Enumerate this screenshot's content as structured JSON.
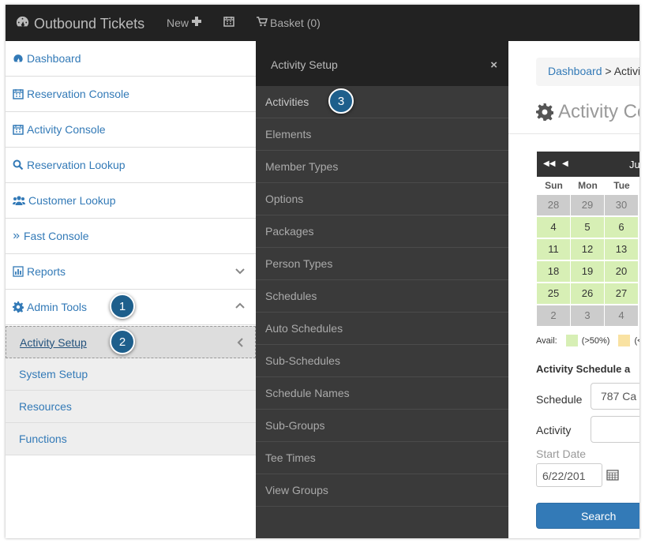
{
  "navbar": {
    "brand": "Outbound Tickets",
    "new_label": "New",
    "basket_label": "Basket (0)"
  },
  "sidebar": {
    "items": [
      {
        "label": "Dashboard",
        "icon": "dashboard-icon"
      },
      {
        "label": "Reservation Console",
        "icon": "calendar-icon"
      },
      {
        "label": "Activity Console",
        "icon": "calendar-icon"
      },
      {
        "label": "Reservation Lookup",
        "icon": "search-icon"
      },
      {
        "label": "Customer Lookup",
        "icon": "users-icon"
      },
      {
        "label": "Fast Console",
        "icon": "double-chevron-right-icon"
      },
      {
        "label": "Reports",
        "icon": "bar-chart-icon"
      },
      {
        "label": "Admin Tools",
        "icon": "gear-icon"
      }
    ],
    "subitems": [
      {
        "label": "Activity Setup"
      },
      {
        "label": "System Setup"
      },
      {
        "label": "Resources"
      },
      {
        "label": "Functions"
      }
    ]
  },
  "callouts": [
    "1",
    "2",
    "3"
  ],
  "flyout": {
    "title": "Activity Setup",
    "close": "×",
    "items": [
      "Activities",
      "Elements",
      "Member Types",
      "Options",
      "Packages",
      "Person Types",
      "Schedules",
      "Auto Schedules",
      "Sub-Schedules",
      "Schedule Names",
      "Sub-Groups",
      "Tee Times",
      "View Groups"
    ]
  },
  "main": {
    "breadcrumb_link": "Dashboard",
    "breadcrumb_sep": " > ",
    "breadcrumb_current": "Activi",
    "title": "Activity Co",
    "calendar": {
      "month": "Ju",
      "days": [
        "Sun",
        "Mon",
        "Tue"
      ],
      "rows": [
        [
          "28",
          "29",
          "30"
        ],
        [
          "4",
          "5",
          "6"
        ],
        [
          "11",
          "12",
          "13"
        ],
        [
          "18",
          "19",
          "20"
        ],
        [
          "25",
          "26",
          "27"
        ],
        [
          "2",
          "3",
          "4"
        ]
      ],
      "avail_color": "#d7efb5",
      "other_color": "#ccc"
    },
    "legend": {
      "label": "Avail:",
      "item1": "(>50%)",
      "item2": "(<",
      "color1": "#d7efb5",
      "color2": "#f9e2a2"
    },
    "section_title": "Activity Schedule a",
    "schedule_label": "Schedule",
    "schedule_value": "787 Ca",
    "activity_label": "Activity",
    "activity_value": "",
    "start_date_label": "Start Date",
    "start_date_value": "6/22/201",
    "search_label": "Search"
  }
}
